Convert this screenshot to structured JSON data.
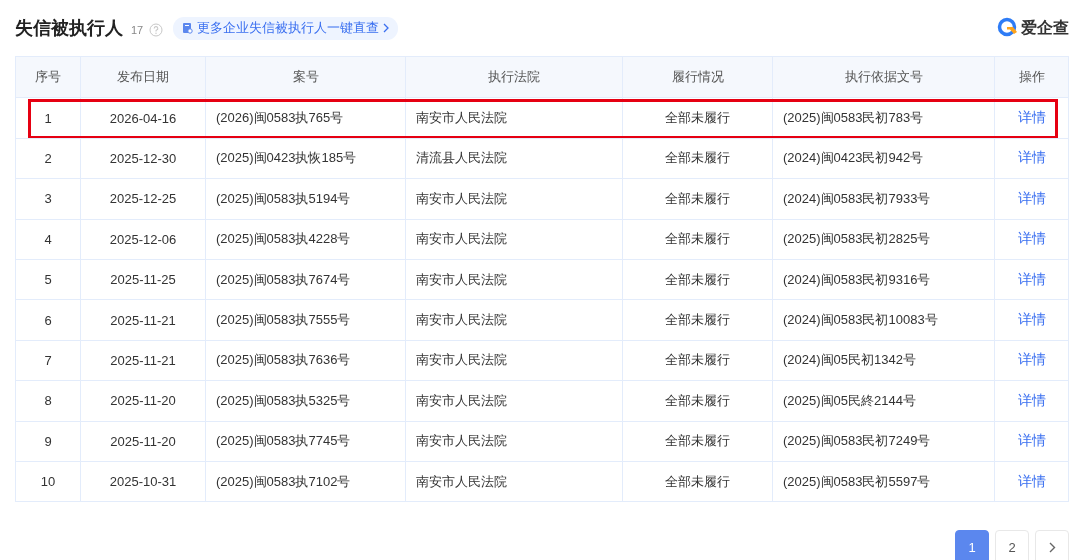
{
  "header": {
    "title": "失信被执行人",
    "count": "17",
    "promo_link": "更多企业失信被执行人一键直查",
    "logo_text": "爱企查"
  },
  "table": {
    "columns": [
      "序号",
      "发布日期",
      "案号",
      "执行法院",
      "履行情况",
      "执行依据文号",
      "操作"
    ],
    "rows": [
      {
        "index": "1",
        "date": "2026-04-16",
        "case_no": "(2026)闽0583执765号",
        "court": "南安市人民法院",
        "status": "全部未履行",
        "basis": "(2025)闽0583民初783号",
        "action": "详情",
        "highlighted": true
      },
      {
        "index": "2",
        "date": "2025-12-30",
        "case_no": "(2025)闽0423执恢185号",
        "court": "清流县人民法院",
        "status": "全部未履行",
        "basis": "(2024)闽0423民初942号",
        "action": "详情",
        "highlighted": false
      },
      {
        "index": "3",
        "date": "2025-12-25",
        "case_no": "(2025)闽0583执5194号",
        "court": "南安市人民法院",
        "status": "全部未履行",
        "basis": "(2024)闽0583民初7933号",
        "action": "详情",
        "highlighted": false
      },
      {
        "index": "4",
        "date": "2025-12-06",
        "case_no": "(2025)闽0583执4228号",
        "court": "南安市人民法院",
        "status": "全部未履行",
        "basis": "(2025)闽0583民初2825号",
        "action": "详情",
        "highlighted": false
      },
      {
        "index": "5",
        "date": "2025-11-25",
        "case_no": "(2025)闽0583执7674号",
        "court": "南安市人民法院",
        "status": "全部未履行",
        "basis": "(2024)闽0583民初9316号",
        "action": "详情",
        "highlighted": false
      },
      {
        "index": "6",
        "date": "2025-11-21",
        "case_no": "(2025)闽0583执7555号",
        "court": "南安市人民法院",
        "status": "全部未履行",
        "basis": "(2024)闽0583民初10083号",
        "action": "详情",
        "highlighted": false
      },
      {
        "index": "7",
        "date": "2025-11-21",
        "case_no": "(2025)闽0583执7636号",
        "court": "南安市人民法院",
        "status": "全部未履行",
        "basis": "(2024)闽05民初1342号",
        "action": "详情",
        "highlighted": false
      },
      {
        "index": "8",
        "date": "2025-11-20",
        "case_no": "(2025)闽0583执5325号",
        "court": "南安市人民法院",
        "status": "全部未履行",
        "basis": "(2025)闽05民終2144号",
        "action": "详情",
        "highlighted": false
      },
      {
        "index": "9",
        "date": "2025-11-20",
        "case_no": "(2025)闽0583执7745号",
        "court": "南安市人民法院",
        "status": "全部未履行",
        "basis": "(2025)闽0583民初7249号",
        "action": "详情",
        "highlighted": false
      },
      {
        "index": "10",
        "date": "2025-10-31",
        "case_no": "(2025)闽0583执7102号",
        "court": "南安市人民法院",
        "status": "全部未履行",
        "basis": "(2025)闽0583民初5597号",
        "action": "详情",
        "highlighted": false
      }
    ]
  },
  "pagination": {
    "pages": [
      {
        "label": "1",
        "selected": true
      },
      {
        "label": "2",
        "selected": false
      }
    ]
  }
}
